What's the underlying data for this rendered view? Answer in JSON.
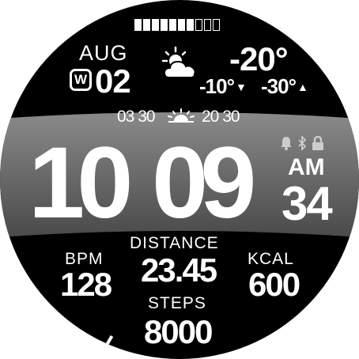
{
  "battery": {
    "total_segments": 10,
    "filled_segments": 7
  },
  "date": {
    "month": "AUG",
    "weekday_letter": "W",
    "day": "02"
  },
  "weather": {
    "icon": "partly-cloudy-icon",
    "current_temp": "-20°",
    "low_temp": "-10°",
    "high_temp": "-30°",
    "low_arrow": "▼",
    "high_arrow": "▲"
  },
  "sun": {
    "sunrise": "03 30",
    "sunset": "20 30",
    "icon": "sunrise-icon"
  },
  "time": {
    "hours": "10",
    "minutes": "09",
    "ampm": "AM",
    "seconds": "34"
  },
  "status": {
    "icons": [
      "bell-icon",
      "bluetooth-icon",
      "lock-icon"
    ]
  },
  "metrics": {
    "bpm_label": "BPM",
    "bpm_value": "128",
    "distance_label": "DISTANCE",
    "distance_value": "23.45",
    "kcal_label": "KCAL",
    "kcal_value": "600",
    "steps_label": "STEPS",
    "steps_value": "8000"
  },
  "colors": {
    "background": "#000000",
    "band": "#6e6e6e",
    "text": "#ffffff"
  }
}
